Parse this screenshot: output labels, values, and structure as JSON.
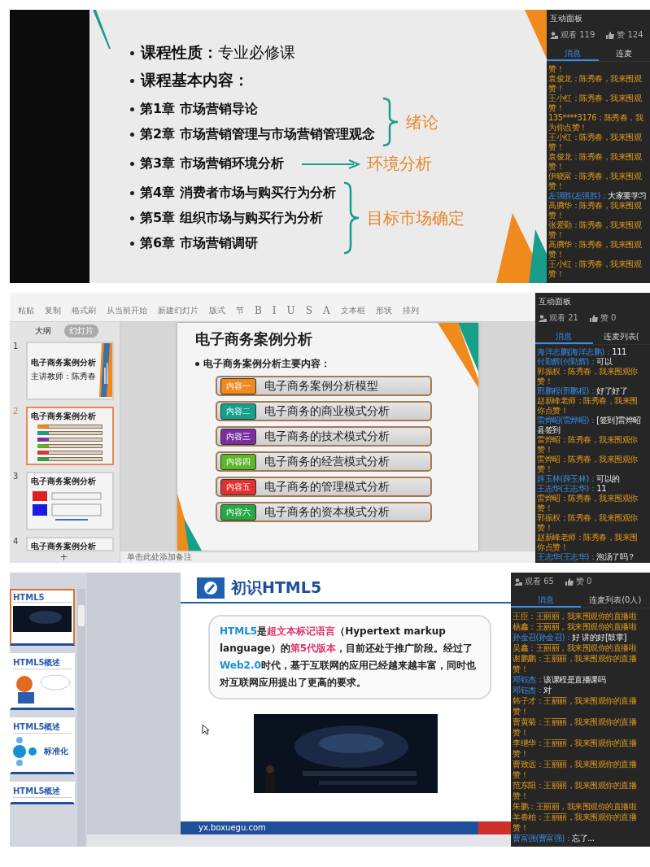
{
  "lecture_1": {
    "slide": {
      "nature_label": "课程性质：",
      "nature_value": "专业必修课",
      "content_heading": "课程基本内容：",
      "groups": [
        {
          "chapters": [
            "第1章  市场营销导论",
            "第2章  市场营销管理与市场营销管理观念"
          ],
          "kind": "brace",
          "note": "绪论"
        },
        {
          "chapters": [
            "第3章  市场营销环境分析"
          ],
          "kind": "arrow",
          "note": "环境分析"
        },
        {
          "chapters": [
            "第4章  消费者市场与购买行为分析",
            "第5章  组织市场与购买行为分析",
            "第6章  市场营销调研"
          ],
          "kind": "brace",
          "note": "目标市场确定"
        }
      ]
    },
    "chat": {
      "title": "互动面板",
      "viewers": "观看 119",
      "likes": "赞 124",
      "tabs": [
        {
          "label": "消息",
          "selected": true
        },
        {
          "label": "连麦",
          "selected": false
        }
      ],
      "messages": [
        {
          "kind": "gift",
          "text": "赞！"
        },
        {
          "kind": "gift",
          "text": "袁俊龙：陈秀春，我来围观"
        },
        {
          "kind": "gift",
          "text": "赞！"
        },
        {
          "kind": "gift",
          "text": "王小红：陈秀春，我来围观"
        },
        {
          "kind": "gift",
          "text": "赞！"
        },
        {
          "kind": "gift",
          "text": "135****3176：陈秀春，我"
        },
        {
          "kind": "gift",
          "text": "为你点赞！"
        },
        {
          "kind": "gift",
          "text": "王小红：陈秀春，我来围观"
        },
        {
          "kind": "gift",
          "text": "赞！"
        },
        {
          "kind": "gift",
          "text": "袁俊龙：陈秀春，我来围观"
        },
        {
          "kind": "gift",
          "text": "赞！"
        },
        {
          "kind": "gift",
          "text": "伊晓富：陈秀春，我来围观"
        },
        {
          "kind": "gift",
          "text": "赞！"
        },
        {
          "kind": "chat",
          "name": "左强胜(左强胜)：",
          "text": "大家要学习"
        },
        {
          "kind": "gift",
          "text": "高腾华：陈秀春，我来围观"
        },
        {
          "kind": "gift",
          "text": "赞！"
        },
        {
          "kind": "gift",
          "text": "张爱勤：陈秀春，我来围观"
        },
        {
          "kind": "gift",
          "text": "赞！"
        },
        {
          "kind": "gift",
          "text": "高腾华：陈秀春，我来围观"
        },
        {
          "kind": "gift",
          "text": "赞！"
        },
        {
          "kind": "gift",
          "text": "王小红：陈秀春，我来围观"
        },
        {
          "kind": "gift",
          "text": "赞！"
        }
      ]
    }
  },
  "lecture_2": {
    "toolbar": {
      "items": [
        {
          "label": "粘贴",
          "kind": "command"
        },
        {
          "label": "复制",
          "kind": "command"
        },
        {
          "label": "格式刷",
          "kind": "command"
        },
        {
          "label": "从当前开始",
          "kind": "command"
        },
        {
          "label": "新建幻灯片",
          "kind": "command"
        },
        {
          "label": "版式",
          "kind": "command"
        },
        {
          "label": "节",
          "kind": "command"
        },
        {
          "label": "B",
          "kind": "format"
        },
        {
          "label": "I",
          "kind": "format"
        },
        {
          "label": "U",
          "kind": "format"
        },
        {
          "label": "S",
          "kind": "format"
        },
        {
          "label": "A",
          "kind": "format"
        },
        {
          "label": "文本框",
          "kind": "command"
        },
        {
          "label": "形状",
          "kind": "command"
        },
        {
          "label": "排列",
          "kind": "command"
        }
      ]
    },
    "sidebar": {
      "tabs": [
        {
          "label": "大纲",
          "selected": false
        },
        {
          "label": "幻灯片",
          "selected": true
        }
      ],
      "thumbnails": [
        {
          "number": "1",
          "title": "电子商务案例分析",
          "subtitle": "主讲教师：陈秀春",
          "selected": false,
          "kind": "cover"
        },
        {
          "number": "2",
          "title": "电子商务案例分析",
          "selected": true,
          "kind": "list"
        },
        {
          "number": "3",
          "title": "电子商务案例分析",
          "selected": false,
          "kind": "boxes"
        },
        {
          "number": "4",
          "title": "电子商务案例分析",
          "selected": false,
          "kind": "partial"
        }
      ],
      "add_button": "+"
    },
    "slide": {
      "title": "电子商务案例分析",
      "subtitle": "电子商务案例分析主要内容：",
      "items": [
        {
          "badge": "内容一",
          "text": "电子商务案例分析模型",
          "color": "#f0891e"
        },
        {
          "badge": "内容二",
          "text": "电子商务的商业模式分析",
          "color": "#16a08a"
        },
        {
          "badge": "内容三",
          "text": "电子商务的技术模式分析",
          "color": "#7a2ea0"
        },
        {
          "badge": "内容四",
          "text": "电子商务的经营模式分析",
          "color": "#5cb82a"
        },
        {
          "badge": "内容五",
          "text": "电子商务的管理模式分析",
          "color": "#e0312e"
        },
        {
          "badge": "内容六",
          "text": "电子商务的资本模式分析",
          "color": "#27a845"
        }
      ]
    },
    "notes_placeholder": "单击此处添加备注",
    "chat": {
      "title": "互动面板",
      "viewers": "观看 21",
      "likes": "赞 0",
      "tabs": [
        {
          "label": "消息",
          "selected": true
        },
        {
          "label": "连麦列表(",
          "selected": false
        }
      ],
      "messages": [
        {
          "kind": "chat",
          "name": "海洋志鹏(海洋志鹏)：",
          "text": "111"
        },
        {
          "kind": "chat",
          "name": "付勤辉(付勤辉)：",
          "text": "可以"
        },
        {
          "kind": "gift",
          "text": "郭振权：陈秀春，我来围观你"
        },
        {
          "kind": "gift",
          "text": "赞！"
        },
        {
          "kind": "chat",
          "name": "邢鹏程(邢鹏程)：",
          "text": "好了好了"
        },
        {
          "kind": "gift",
          "text": "赵新峰老师：陈秀春，我来围"
        },
        {
          "kind": "gift",
          "text": "你点赞！"
        },
        {
          "kind": "chat",
          "name": "雷烨昭(雷烨昭)：",
          "text": "[签到]雷烨昭"
        },
        {
          "kind": "plain",
          "text": "县签到"
        },
        {
          "kind": "gift",
          "text": "雷烨昭：陈秀春，我来围观你"
        },
        {
          "kind": "gift",
          "text": "赞！"
        },
        {
          "kind": "gift",
          "text": "雷烨昭：陈秀春，我来围观你"
        },
        {
          "kind": "gift",
          "text": "赞！"
        },
        {
          "kind": "chat",
          "name": "薛玉林(薛玉林)：",
          "text": "可以的"
        },
        {
          "kind": "chat",
          "name": "王志华(王志华)：",
          "text": "11"
        },
        {
          "kind": "gift",
          "text": "雷烨昭：陈秀春，我来围观你"
        },
        {
          "kind": "gift",
          "text": "赞！"
        },
        {
          "kind": "gift",
          "text": "郭振权：陈秀春，我来围观你"
        },
        {
          "kind": "gift",
          "text": "赞！"
        },
        {
          "kind": "gift",
          "text": "赵新峰老师：陈秀春，我来围"
        },
        {
          "kind": "gift",
          "text": "你点赞！"
        },
        {
          "kind": "chat",
          "name": "王志华(王志华)：",
          "text": "泡汤了吗？"
        }
      ]
    }
  },
  "lecture_3": {
    "sidebar": {
      "thumbnails": [
        {
          "title": "HTML5",
          "selected": true,
          "kind": "video"
        },
        {
          "title": "HTML5概述",
          "selected": false,
          "kind": "illustration"
        },
        {
          "title": "HTML5概述",
          "caption": "标准化",
          "selected": false,
          "kind": "diagram"
        },
        {
          "title": "HTML5概述",
          "selected": false,
          "kind": "partial"
        }
      ]
    },
    "slide": {
      "title": "初识HTML5",
      "paragraph": [
        {
          "text": "HTML5",
          "color": "#1a8fd6"
        },
        {
          "text": "是"
        },
        {
          "text": "超文本标记语言",
          "color": "#e0336b"
        },
        {
          "text": "（Hypertext markup language）的"
        },
        {
          "text": "第5代版本",
          "color": "#e0336b"
        },
        {
          "text": "，目前还处于推广阶段。经过了"
        },
        {
          "text": "Web2.0",
          "color": "#1a8fd6"
        },
        {
          "text": "时代，基于互联网的应用已经越来越丰富，同时也对互联网应用提出了更高的要求。"
        }
      ],
      "footer": "yx.boxuegu.com"
    },
    "chat": {
      "viewers": "观看 65",
      "likes": "赞 0",
      "tabs": [
        {
          "label": "消息",
          "selected": true
        },
        {
          "label": "连麦列表(0人)",
          "selected": false
        }
      ],
      "messages": [
        {
          "kind": "gift",
          "text": "王臣：王丽丽，我来围观你的直播啦"
        },
        {
          "kind": "gift",
          "text": "杨鑫：王丽丽，我来围观你的直播啦"
        },
        {
          "kind": "chat",
          "name": "孙金召(孙金召)：",
          "text": "好 讲的好[鼓掌]"
        },
        {
          "kind": "gift",
          "text": "吴鑫：王丽丽，我来围观你的直播啦"
        },
        {
          "kind": "gift",
          "text": "谢鹏鹏：王丽丽，我来围观你的直播"
        },
        {
          "kind": "gift",
          "text": "赞！"
        },
        {
          "kind": "chat",
          "name": "邓钰杰：",
          "text": "该课程是直播课吗"
        },
        {
          "kind": "chat",
          "name": "邓钰杰：",
          "text": "对"
        },
        {
          "kind": "gift",
          "text": "韩子才：王丽丽，我来围观你的直播"
        },
        {
          "kind": "gift",
          "text": "赞！"
        },
        {
          "kind": "gift",
          "text": "曹黄菊：王丽丽，我来围观你的直播"
        },
        {
          "kind": "gift",
          "text": "赞！"
        },
        {
          "kind": "gift",
          "text": "李继华：王丽丽，我来围观你的直播"
        },
        {
          "kind": "gift",
          "text": "赞！"
        },
        {
          "kind": "gift",
          "text": "曹致远：王丽丽，我来围观你的直播"
        },
        {
          "kind": "gift",
          "text": "赞！"
        },
        {
          "kind": "gift",
          "text": "范东阳：王丽丽，我来围观你的直播"
        },
        {
          "kind": "gift",
          "text": "赞！"
        },
        {
          "kind": "gift",
          "text": "朱鹏：王丽丽，我来围观你的直播啦"
        },
        {
          "kind": "gift",
          "text": "羊春柏：王丽丽，我来围观你的直播"
        },
        {
          "kind": "gift",
          "text": "赞！"
        },
        {
          "kind": "chat",
          "name": "曹富强(曹富强)：",
          "text": "忘了..."
        }
      ]
    }
  }
}
